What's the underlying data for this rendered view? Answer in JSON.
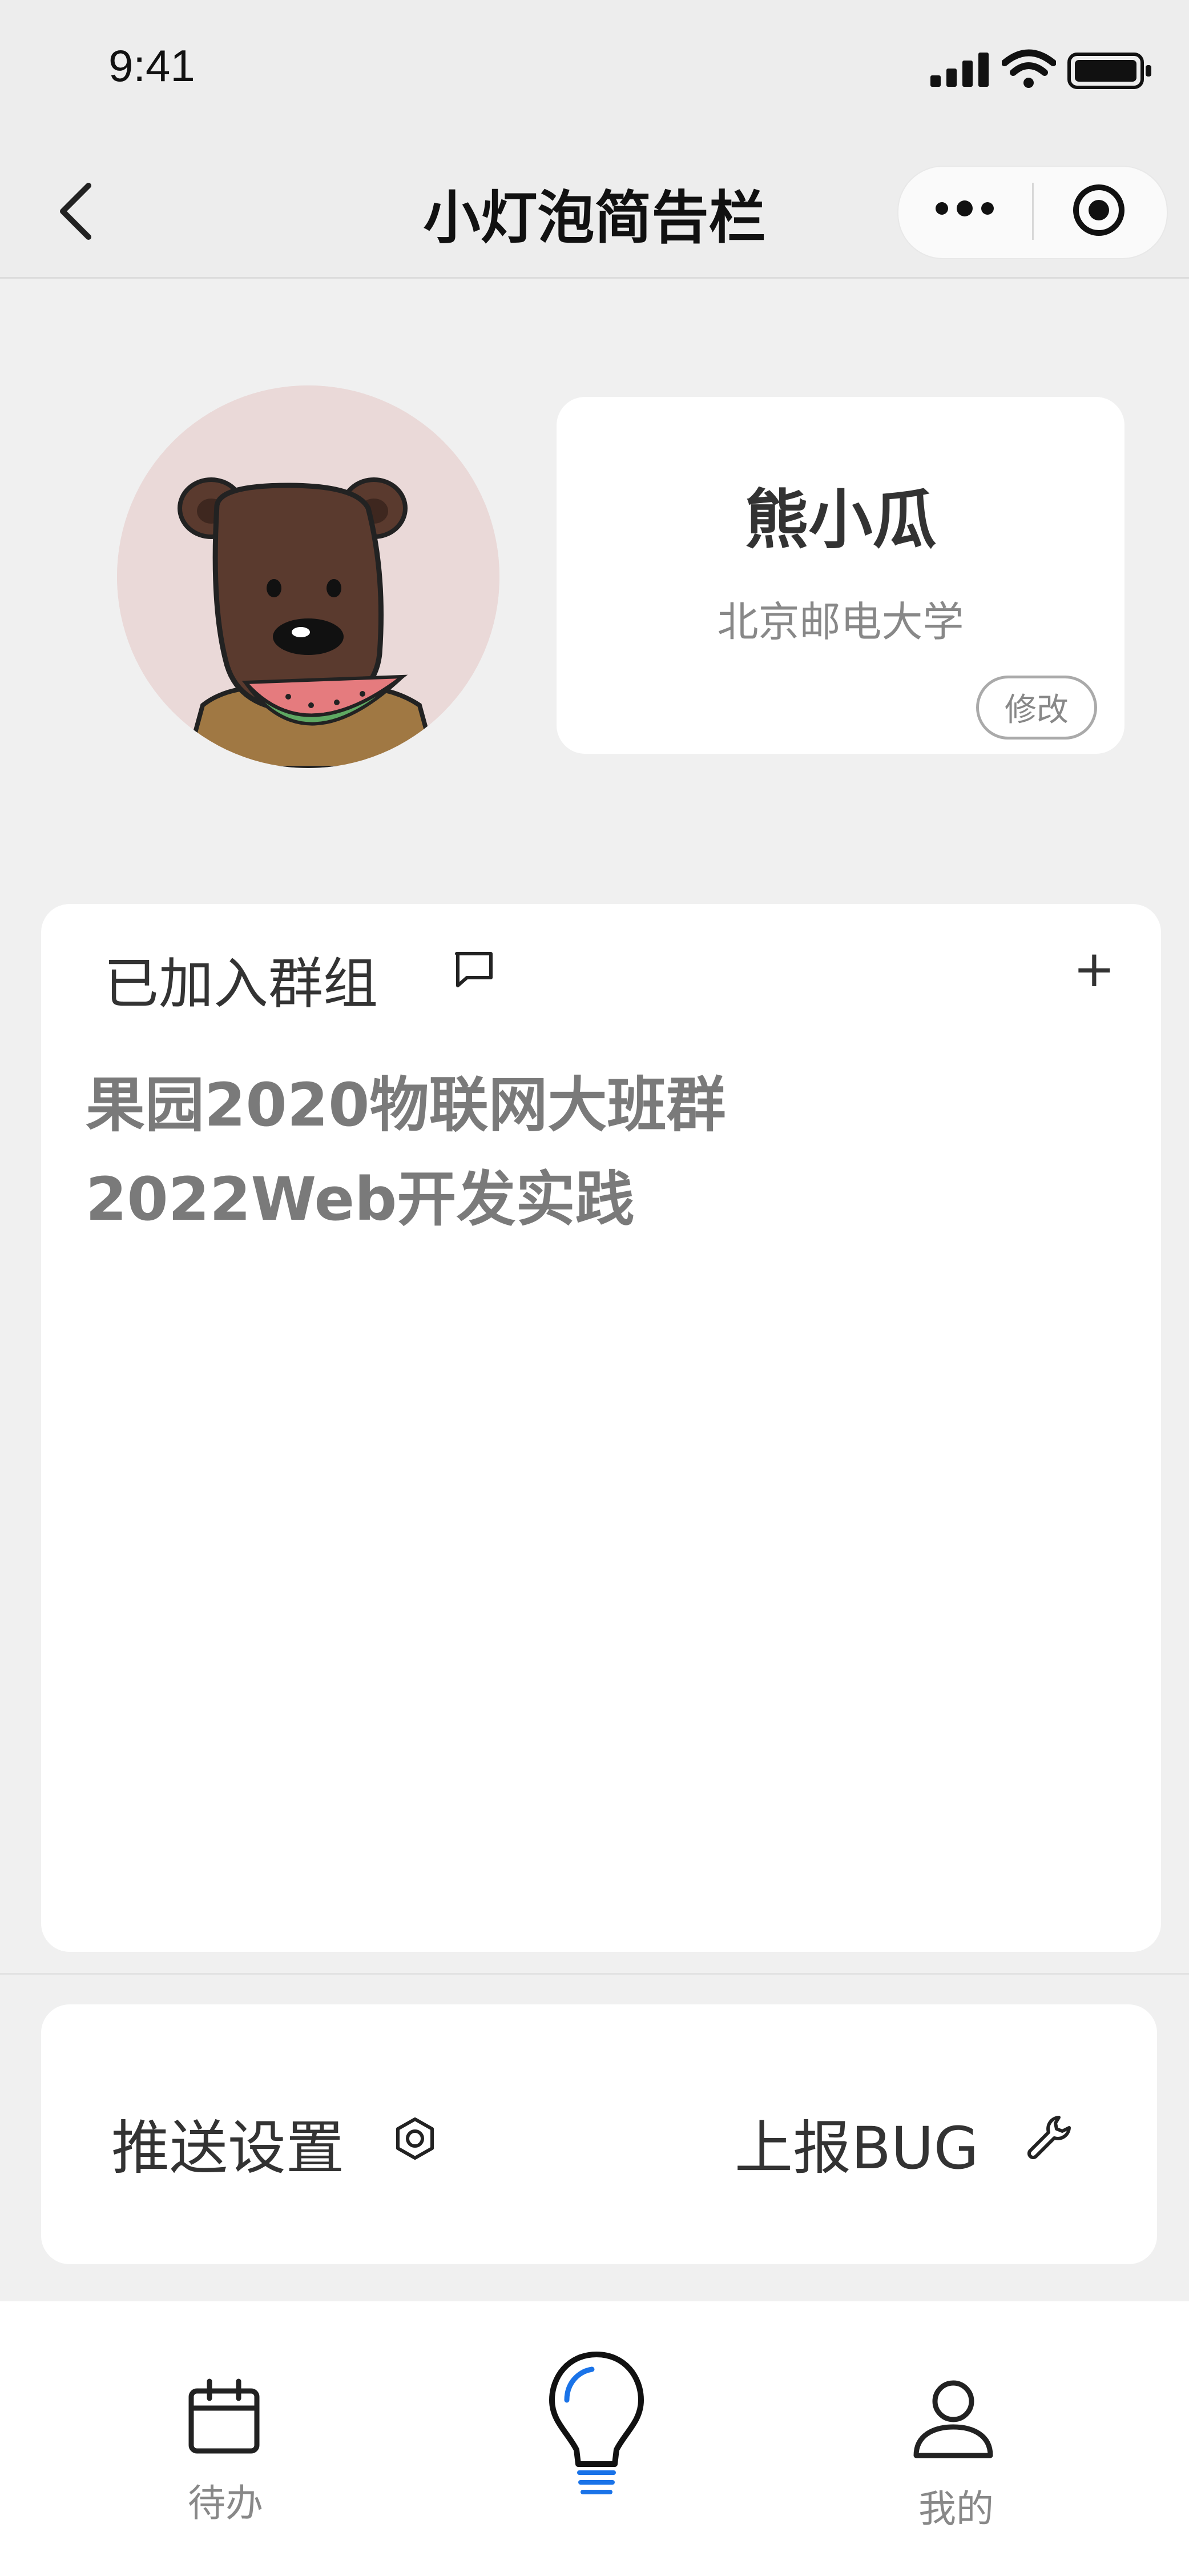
{
  "status_bar": {
    "time": "9:41"
  },
  "nav": {
    "title": "小灯泡简告栏"
  },
  "profile": {
    "name": "熊小瓜",
    "school": "北京邮电大学",
    "edit_label": "修改"
  },
  "groups": {
    "title": "已加入群组",
    "add_symbol": "+",
    "items": [
      "果园2020物联网大班群",
      "2022Web开发实践"
    ]
  },
  "settings": {
    "push_label": "推送设置",
    "bug_label": "上报BUG"
  },
  "tabbar": {
    "items": [
      {
        "label": "待办",
        "icon": "calendar-icon"
      },
      {
        "label": "",
        "icon": "lightbulb-icon"
      },
      {
        "label": "我的",
        "icon": "person-icon"
      }
    ]
  },
  "colors": {
    "background": "#f0f0f0",
    "card": "#ffffff",
    "accent": "#1a73e8",
    "group_text": "#7a7a7a"
  }
}
